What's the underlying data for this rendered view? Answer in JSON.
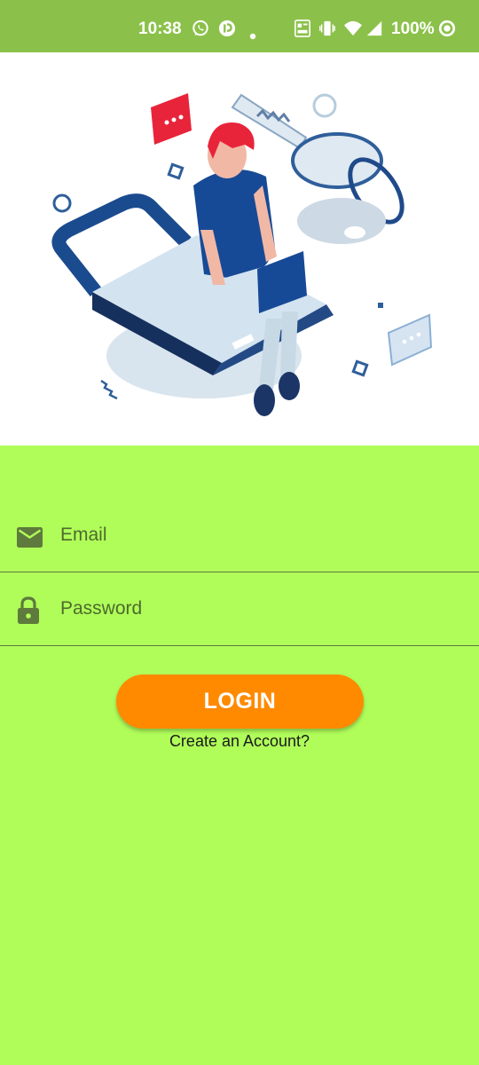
{
  "status_bar": {
    "time": "10:38",
    "battery": "100%",
    "icons": [
      "whatsapp-icon",
      "app-notification-icon",
      "dot-icon",
      "volte-icon",
      "vibrate-icon",
      "wifi-icon",
      "signal-icon",
      "battery-ring-icon"
    ]
  },
  "hero": {
    "illustration": "person-with-laptop-padlock-key-illustration"
  },
  "form": {
    "email_placeholder": "Email",
    "password_placeholder": "Password",
    "email_icon": "mail-icon",
    "password_icon": "lock-icon"
  },
  "actions": {
    "login_label": "LOGIN",
    "create_account_label": "Create an Account?"
  },
  "colors": {
    "status_bar": "#8bc14a",
    "background": "#b0fd5a",
    "accent": "#ff8a00",
    "icon": "#5e7a3c"
  }
}
